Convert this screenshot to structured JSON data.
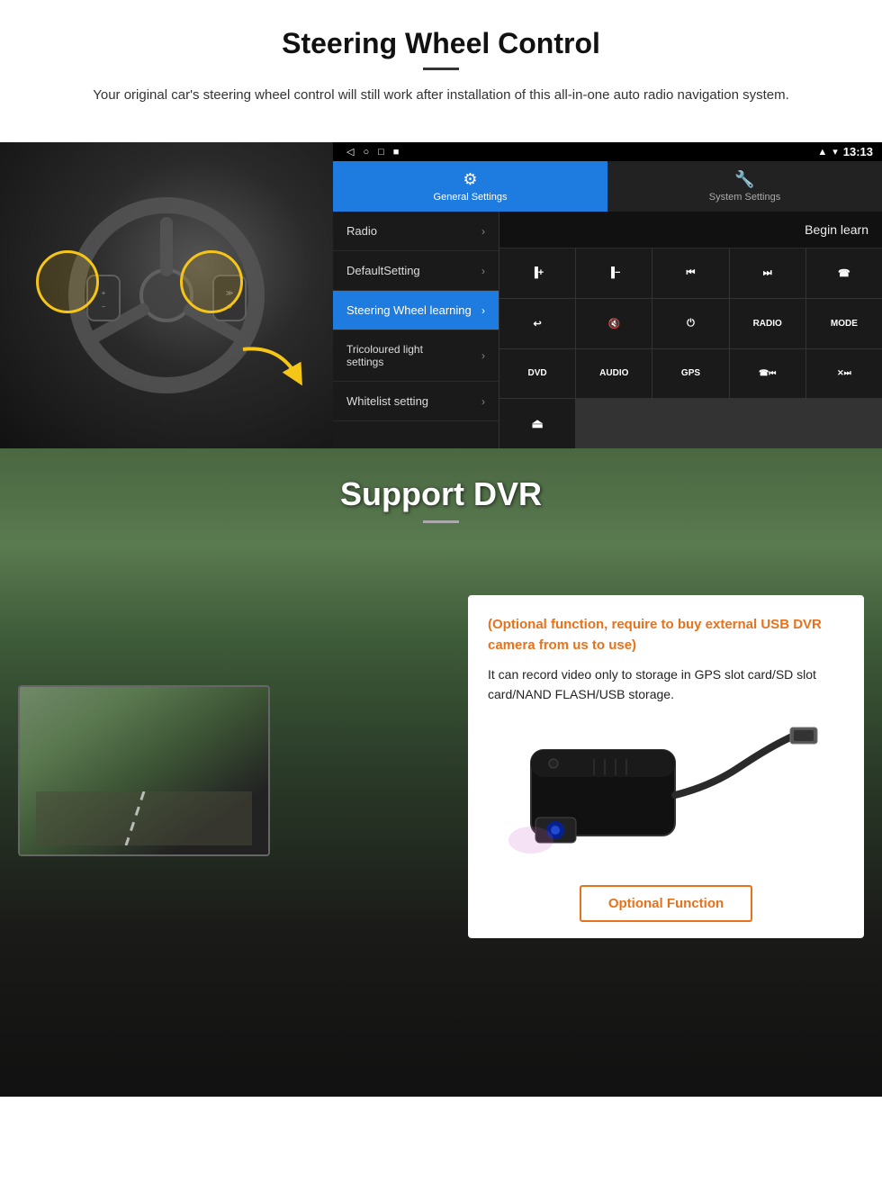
{
  "steering": {
    "title": "Steering Wheel Control",
    "description": "Your original car's steering wheel control will still work after installation of this all-in-one auto radio navigation system.",
    "statusbar": {
      "time": "13:13",
      "icons": [
        "◁",
        "○",
        "□",
        "■"
      ]
    },
    "tabs": [
      {
        "id": "general",
        "label": "General Settings",
        "icon": "⚙",
        "active": true
      },
      {
        "id": "system",
        "label": "System Settings",
        "icon": "🔧",
        "active": false
      }
    ],
    "menu": [
      {
        "label": "Radio",
        "active": false
      },
      {
        "label": "DefaultSetting",
        "active": false
      },
      {
        "label": "Steering Wheel learning",
        "active": true
      },
      {
        "label": "Tricoloured light settings",
        "active": false
      },
      {
        "label": "Whitelist setting",
        "active": false
      }
    ],
    "begin_learn": "Begin learn",
    "controls": [
      "▐+",
      "▐−",
      "⏮",
      "⏭",
      "☎",
      "↩",
      "◁×",
      "⏻",
      "RADIO",
      "MODE",
      "DVD",
      "AUDIO",
      "GPS",
      "☎⏮",
      "✕⏭"
    ]
  },
  "dvr": {
    "title": "Support DVR",
    "optional_heading": "(Optional function, require to buy external USB DVR camera from us to use)",
    "body_text": "It can record video only to storage in GPS slot card/SD slot card/NAND FLASH/USB storage.",
    "optional_btn_label": "Optional Function"
  }
}
